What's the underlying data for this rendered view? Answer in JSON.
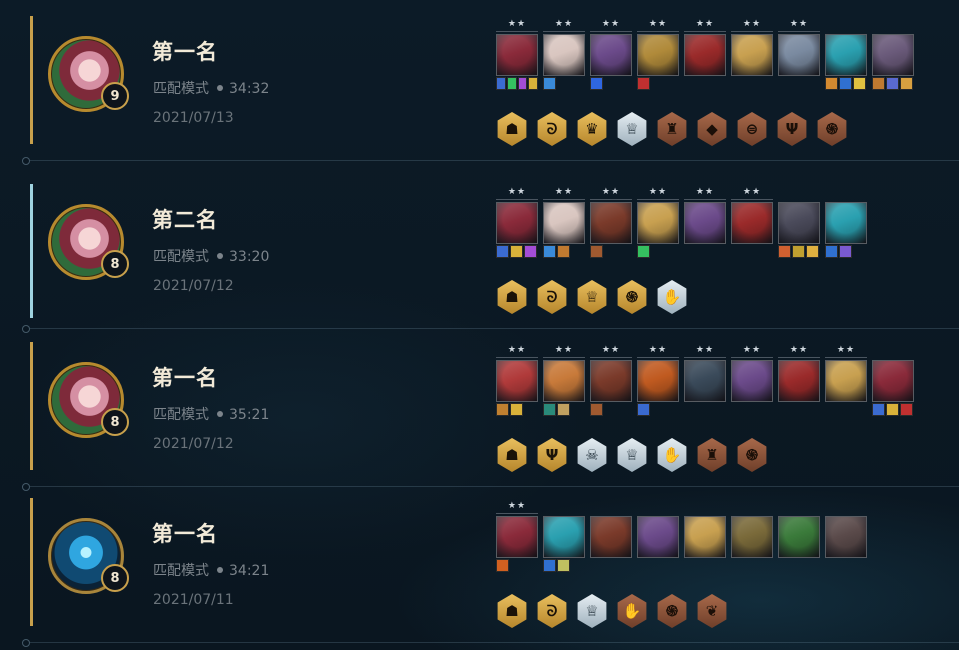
{
  "matches": [
    {
      "placement": "第一名",
      "mode": "匹配模式",
      "duration": "34:32",
      "date": "2021/07/13",
      "level": "9",
      "avatar": "pink-hooded-avatar",
      "accent_color": "#c8a04c",
      "units": [
        {
          "stars": "★★",
          "color": "#8a2a3a",
          "items": [
            "#3b6bd0",
            "#35c060",
            "#a34dd6",
            "#d9b23a"
          ]
        },
        {
          "stars": "★★",
          "color": "#d9c6c0",
          "items": [
            "#3a8ad8"
          ]
        },
        {
          "stars": "★★",
          "color": "#6b4a8a",
          "items": [
            "#2f66e0"
          ]
        },
        {
          "stars": "★★",
          "color": "#b08a3a",
          "items": [
            "#c03030"
          ]
        },
        {
          "stars": "★★",
          "color": "#9a2a2a",
          "items": []
        },
        {
          "stars": "★★",
          "color": "#c8a050",
          "items": []
        },
        {
          "stars": "★★",
          "color": "#7a8aa0",
          "items": []
        },
        {
          "stars": "",
          "color": "#2aa0b0",
          "items": [
            "#d48a30",
            "#3070d0",
            "#e0c040"
          ]
        },
        {
          "stars": "",
          "color": "#6a5a7a",
          "items": [
            "#c07a30",
            "#5a6ad0",
            "#d8a040"
          ]
        }
      ],
      "traits": [
        {
          "tier": "gold",
          "icon": "☗"
        },
        {
          "tier": "gold",
          "icon": "ᘐ"
        },
        {
          "tier": "gold",
          "icon": "♛"
        },
        {
          "tier": "silver",
          "icon": "♕"
        },
        {
          "tier": "bronze",
          "icon": "♜"
        },
        {
          "tier": "bronze",
          "icon": "◆"
        },
        {
          "tier": "bronze",
          "icon": "⊜"
        },
        {
          "tier": "bronze",
          "icon": "Ψ"
        },
        {
          "tier": "bronze",
          "icon": "֍"
        }
      ]
    },
    {
      "placement": "第二名",
      "mode": "匹配模式",
      "duration": "33:20",
      "date": "2021/07/12",
      "level": "8",
      "avatar": "pink-hooded-avatar",
      "accent_color": "#9fd3e0",
      "units": [
        {
          "stars": "★★",
          "color": "#8a2a3a",
          "items": [
            "#3b6bd0",
            "#d9b23a",
            "#a34dd6"
          ]
        },
        {
          "stars": "★★",
          "color": "#d9c6c0",
          "items": [
            "#3a8ad8",
            "#c07a30"
          ]
        },
        {
          "stars": "★★",
          "color": "#7a3a2a",
          "items": [
            "#a05a30"
          ]
        },
        {
          "stars": "★★",
          "color": "#c8a050",
          "items": [
            "#35c060"
          ]
        },
        {
          "stars": "★★",
          "color": "#6b4a8a",
          "items": []
        },
        {
          "stars": "★★",
          "color": "#9a2a2a",
          "items": []
        },
        {
          "stars": "",
          "color": "#4a4a5a",
          "items": [
            "#d06030",
            "#c0a030",
            "#e0b040"
          ]
        },
        {
          "stars": "",
          "color": "#2aa0b0",
          "items": [
            "#3070d0",
            "#7a5ad0"
          ]
        }
      ],
      "traits": [
        {
          "tier": "gold",
          "icon": "☗"
        },
        {
          "tier": "gold",
          "icon": "ᘐ"
        },
        {
          "tier": "gold",
          "icon": "♕"
        },
        {
          "tier": "gold",
          "icon": "֍"
        },
        {
          "tier": "silver",
          "icon": "✋"
        }
      ]
    },
    {
      "placement": "第一名",
      "mode": "匹配模式",
      "duration": "35:21",
      "date": "2021/07/12",
      "level": "8",
      "avatar": "pink-hooded-avatar",
      "accent_color": "#c8a04c",
      "units": [
        {
          "stars": "★★",
          "color": "#b03a3a",
          "items": [
            "#c08030",
            "#d9b23a"
          ]
        },
        {
          "stars": "★★",
          "color": "#c87a3a",
          "items": [
            "#2a8a7a",
            "#c0a060"
          ]
        },
        {
          "stars": "★★",
          "color": "#7a3a2a",
          "items": [
            "#a05a30"
          ]
        },
        {
          "stars": "★★",
          "color": "#c05a20",
          "items": [
            "#3a6ad0"
          ]
        },
        {
          "stars": "★★",
          "color": "#3a4a5a",
          "items": []
        },
        {
          "stars": "★★",
          "color": "#6b4a8a",
          "items": []
        },
        {
          "stars": "★★",
          "color": "#9a2a2a",
          "items": []
        },
        {
          "stars": "★★",
          "color": "#c8a050",
          "items": []
        },
        {
          "stars": "",
          "color": "#8a2a3a",
          "items": [
            "#3b6bd0",
            "#d9b23a",
            "#c03030"
          ]
        }
      ],
      "traits": [
        {
          "tier": "gold",
          "icon": "☗"
        },
        {
          "tier": "gold",
          "icon": "Ψ"
        },
        {
          "tier": "silver",
          "icon": "☠"
        },
        {
          "tier": "silver",
          "icon": "♕"
        },
        {
          "tier": "silver",
          "icon": "✋"
        },
        {
          "tier": "bronze",
          "icon": "♜"
        },
        {
          "tier": "bronze",
          "icon": "֍"
        }
      ]
    },
    {
      "placement": "第一名",
      "mode": "匹配模式",
      "duration": "34:21",
      "date": "2021/07/11",
      "level": "8",
      "avatar": "blue-spirit-avatar",
      "accent_color": "#c8a04c",
      "units": [
        {
          "stars": "★★",
          "color": "#8a2a3a",
          "items": [
            "#d06020"
          ]
        },
        {
          "stars": "",
          "color": "#2aa0b0",
          "items": [
            "#3070d0",
            "#c0c060"
          ]
        },
        {
          "stars": "",
          "color": "#7a3a2a",
          "items": []
        },
        {
          "stars": "",
          "color": "#6b4a8a",
          "items": []
        },
        {
          "stars": "",
          "color": "#c8a050",
          "items": []
        },
        {
          "stars": "",
          "color": "#7a6a3a",
          "items": []
        },
        {
          "stars": "",
          "color": "#3a7a3a",
          "items": []
        },
        {
          "stars": "",
          "color": "#5a4a4a",
          "items": []
        }
      ],
      "traits": [
        {
          "tier": "gold",
          "icon": "☗"
        },
        {
          "tier": "gold",
          "icon": "ᘐ"
        },
        {
          "tier": "silver",
          "icon": "♕"
        },
        {
          "tier": "bronze",
          "icon": "✋"
        },
        {
          "tier": "bronze",
          "icon": "֍"
        },
        {
          "tier": "bronze",
          "icon": "❦"
        }
      ]
    }
  ]
}
